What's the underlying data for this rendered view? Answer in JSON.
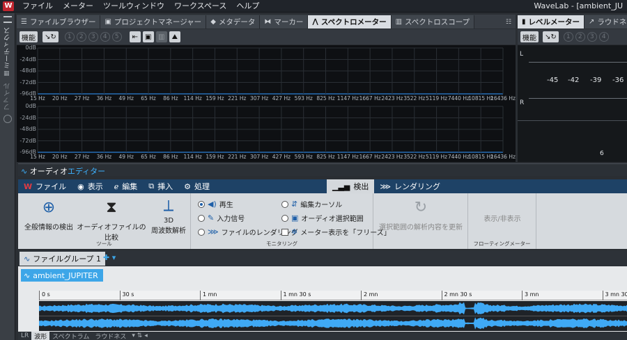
{
  "app": {
    "logo": "W",
    "title": "WaveLab - [ambient_JU"
  },
  "menu": [
    "ファイル",
    "メーター",
    "ツールウィンドウ",
    "ワークスペース",
    "ヘルプ"
  ],
  "left_strip": {
    "label_1": "ミーティクス",
    "label_2": "ファイル"
  },
  "top_tabs": [
    {
      "label": "ファイルブラウザー",
      "icon": "list-icon"
    },
    {
      "label": "プロジェクトマネージャー",
      "icon": "folder-icon"
    },
    {
      "label": "メタデータ",
      "icon": "tag-icon"
    },
    {
      "label": "マーカー",
      "icon": "marker-icon"
    },
    {
      "label": "スペクトロメーター",
      "icon": "spectro-icon"
    },
    {
      "label": "スペクトロスコープ",
      "icon": "bars-icon"
    }
  ],
  "right_tabs": [
    {
      "label": "レベルメーター"
    },
    {
      "label": "ラウドネスメー"
    }
  ],
  "toolbar": {
    "function_label": "機能",
    "presets": [
      "1",
      "2",
      "3",
      "4",
      "5"
    ]
  },
  "level_toolbar": {
    "function_label": "機能",
    "presets": [
      "1",
      "2",
      "3",
      "4"
    ]
  },
  "spectrum": {
    "y_ticks": [
      "0dB",
      "-24dB",
      "-48dB",
      "-72dB",
      "-96dB"
    ],
    "x_ticks": [
      "15 Hz",
      "20 Hz",
      "27 Hz",
      "36 Hz",
      "49 Hz",
      "65 Hz",
      "86 Hz",
      "114 Hz",
      "159 Hz",
      "221 Hz",
      "307 Hz",
      "427 Hz",
      "593 Hz",
      "825 Hz",
      "1147 Hz",
      "1667 Hz",
      "2423 Hz",
      "3522 Hz",
      "5119 Hz",
      "7440 Hz",
      "10815 Hz",
      "16436 Hz"
    ]
  },
  "level_meter": {
    "channel_l": "L",
    "channel_r": "R",
    "scale": [
      "-45",
      "-42",
      "-39",
      "-36"
    ],
    "bottom_value": "6"
  },
  "audio_editor": {
    "prefix": "オーディオ",
    "suffix": "エディター"
  },
  "ribbon_tabs": [
    {
      "label": "ファイル",
      "icon": "wavelab-icon"
    },
    {
      "label": "表示",
      "icon": "eye-icon"
    },
    {
      "label": "編集",
      "icon": "edit-icon"
    },
    {
      "label": "挿入",
      "icon": "insert-icon"
    },
    {
      "label": "処理",
      "icon": "process-icon"
    },
    {
      "label": "検出",
      "icon": "analyze-icon",
      "active": true
    },
    {
      "label": "レンダリング",
      "icon": "render-icon"
    }
  ],
  "ribbon": {
    "tools": {
      "btn1": "全般情報の検出",
      "btn2": "オーディオファイルの比較",
      "btn3_line1": "3D",
      "btn3_line2": "周波数解析",
      "group": "ツール"
    },
    "monitoring": {
      "opt_play": "再生",
      "opt_input": "入力信号",
      "opt_render": "ファイルのレンダリング",
      "opt_cursor": "編集カーソル",
      "opt_selection": "オーディオ選択範囲",
      "opt_freeze": "メーター表示を「フリーズ」",
      "group": "モニタリング"
    },
    "update": {
      "label": "選択範囲の解析内容を更新"
    },
    "floating": {
      "label": "表示/非表示",
      "group": "フローティングメーター"
    }
  },
  "file_group": {
    "tab": "ファイルグループ 1"
  },
  "track": {
    "clip_name": "ambient_JUPITER",
    "ruler": [
      "0 s",
      "30 s",
      "1 mn",
      "1 mn 30 s",
      "2 mn",
      "2 mn 30 s",
      "3 mn",
      "3 mn 30 s"
    ],
    "bottom_tabs": [
      "LR",
      "波形",
      "スペクトラム",
      "ラウドネス"
    ]
  },
  "colors": {
    "accent": "#3da6e8",
    "ribbon_tab_bg": "#1e4266",
    "wave": "#3fa9f5",
    "spectrum_line": "#2c7fd6"
  }
}
